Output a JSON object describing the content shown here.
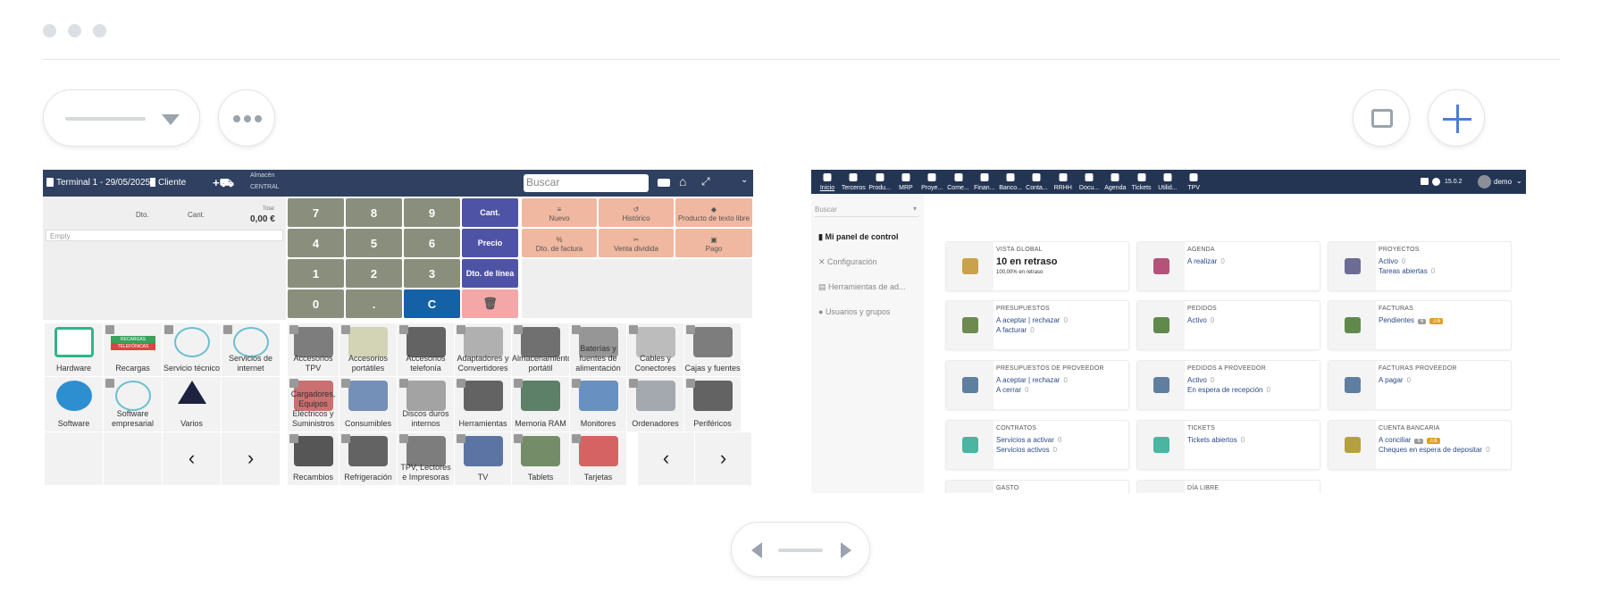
{
  "colors": {
    "pos_bar": "#2f4060",
    "dash_bar": "#243554",
    "key_num": "#8a8f7d",
    "key_blue": "#4f53a6",
    "key_c": "#1561a6",
    "key_del": "#f3a7a7",
    "action": "#f0b8a0",
    "accent": "#4a7fd6"
  },
  "pos": {
    "terminal": "Terminal 1 - 29/05/2025",
    "customer": "Cliente",
    "warehouse_label": "Almacén",
    "warehouse": "CENTRAL",
    "search_placeholder": "Buscar",
    "cols": {
      "dto": "Dto.",
      "cant": "Cant.",
      "total_label": "Total",
      "total": "0,00 €"
    },
    "empty": "Empty",
    "keys": [
      "7",
      "8",
      "9",
      "4",
      "5",
      "6",
      "1",
      "2",
      "3",
      "0",
      ".",
      "C"
    ],
    "side_keys": [
      "Cant.",
      "Precio",
      "Dto. de línea"
    ],
    "actions": [
      {
        "icon": "stack-icon",
        "label": "Nuevo"
      },
      {
        "icon": "history-icon",
        "label": "Histórico"
      },
      {
        "icon": "box-icon",
        "label": "Producto de texto libre"
      },
      {
        "icon": "percent-icon",
        "label": "Dto. de factura"
      },
      {
        "icon": "split-icon",
        "label": "Venta dividida"
      },
      {
        "icon": "cash-icon",
        "label": "Pago"
      }
    ],
    "categories": [
      "Hardware",
      "Recargas",
      "Servicio técnico",
      "Servicios de internet",
      "Software",
      "Software empresarial",
      "Varios"
    ],
    "recargas_badge": [
      "RECARGAS",
      "TELEFÓNICAS"
    ],
    "products": [
      "Accesorios TPV",
      "Accesorios portátiles",
      "Accesorios telefonía",
      "Adaptadores y Convertidores",
      "Almacenamiento portátil",
      "Baterías y fuentes de alimentación",
      "Cables y Conectores",
      "Cajas y fuentes",
      "Cargadores, Equipos Eléctricos y Suministros",
      "Consumibles",
      "Discos duros internos",
      "Herramientas",
      "Memoria RAM",
      "Monitores",
      "Ordenadores",
      "Periféricos",
      "Recambios",
      "Refrigeración",
      "TPV, Lectores e Impresoras",
      "TV",
      "Tablets",
      "Tarjetas"
    ]
  },
  "dash": {
    "menu": [
      "Inicio",
      "Terceros",
      "Produ...",
      "MRP",
      "Proye...",
      "Come...",
      "Finan...",
      "Banco...",
      "Conta...",
      "RRHH",
      "Docu...",
      "Agenda",
      "Tickets",
      "Utilid...",
      "TPV"
    ],
    "version": "15.0.2",
    "user": "demo",
    "search": "Buscar",
    "side": [
      "Mi panel de control",
      "Configuración",
      "Herramientas de ad...",
      "Usuarios y grupos"
    ],
    "cards": [
      {
        "title": "VISTA GLOBAL",
        "big": "10 en retraso",
        "small": "100,00% en retraso",
        "color": "#c9a24a"
      },
      {
        "title": "AGENDA",
        "l1": "A realizar",
        "v1": "0",
        "color": "#b5527a"
      },
      {
        "title": "PROYECTOS",
        "l1": "Activo",
        "v1": "0",
        "l2": "Tareas abiertas",
        "v2": "0",
        "color": "#6c6c96"
      },
      {
        "title": "PRESUPUESTOS",
        "l1": "A aceptar | rechazar",
        "v1": "0",
        "l2": "A facturar",
        "v2": "0",
        "color": "#6d8a4f"
      },
      {
        "title": "PEDIDOS",
        "l1": "Activo",
        "v1": "0",
        "color": "#5f8a4b"
      },
      {
        "title": "FACTURAS",
        "l1": "Pendientes",
        "b1": "6",
        "b2": "6",
        "color": "#5f8a4b"
      },
      {
        "title": "PRESUPUESTOS DE PROVEEDOR",
        "l1": "A aceptar | rechazar",
        "v1": "0",
        "l2": "A cerrar",
        "v2": "0",
        "color": "#5f7fa0"
      },
      {
        "title": "PEDIDOS A PROVEEDOR",
        "l1": "Activo",
        "v1": "0",
        "l2": "En espera de recepción",
        "v2": "0",
        "color": "#5f7fa0"
      },
      {
        "title": "FACTURAS PROVEEDOR",
        "l1": "A pagar",
        "v1": "0",
        "color": "#5f7fa0"
      },
      {
        "title": "CONTRATOS",
        "l1": "Servicios a activar",
        "v1": "0",
        "l2": "Servicios activos",
        "v2": "0",
        "color": "#4ab5a0"
      },
      {
        "title": "TICKETS",
        "l1": "Tickets abiertos",
        "v1": "0",
        "color": "#4ab5a0"
      },
      {
        "title": "CUENTA BANCARIA",
        "l1": "A conciliar",
        "b1": "6",
        "b2": "6",
        "l2": "Cheques en espera de depositar",
        "v2": "0",
        "color": "#b5a040"
      },
      {
        "title": "GASTO",
        "color": "#999"
      },
      {
        "title": "DÍA LIBRE",
        "color": "#999"
      }
    ]
  }
}
